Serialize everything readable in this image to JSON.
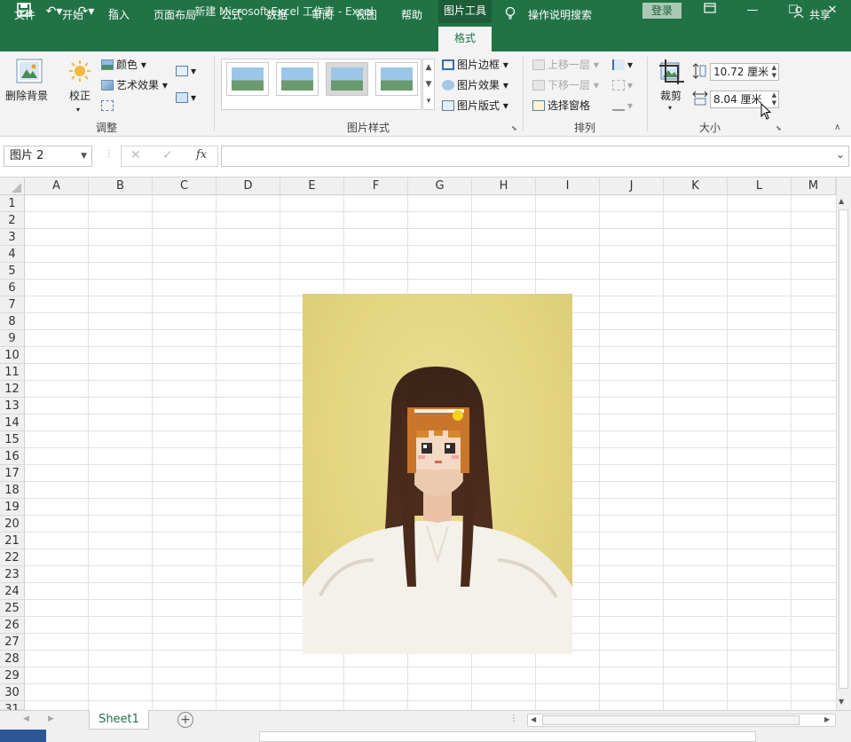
{
  "title_bar": {
    "document_title": "新建 Microsoft Excel 工作表  -  Excel",
    "context_tab_title": "图片工具",
    "login_label": "登录"
  },
  "ribbon_tabs": {
    "file": "文件",
    "home": "开始",
    "insert": "插入",
    "page_layout": "页面布局",
    "formulas": "公式",
    "data": "数据",
    "review": "审阅",
    "view": "视图",
    "help": "帮助",
    "format": "格式",
    "tell_me": "操作说明搜索",
    "share": "共享"
  },
  "ribbon": {
    "adjust": {
      "remove_background": "删除背景",
      "corrections": "校正",
      "color": "颜色",
      "artistic_effects": "艺术效果",
      "group_label": "调整"
    },
    "picture_styles": {
      "picture_border": "图片边框",
      "picture_effects": "图片效果",
      "picture_layout": "图片版式",
      "group_label": "图片样式"
    },
    "arrange": {
      "bring_forward": "上移一层",
      "send_backward": "下移一层",
      "selection_pane": "选择窗格",
      "group_label": "排列"
    },
    "size": {
      "crop": "裁剪",
      "height": "10.72 厘米",
      "width": "8.04 厘米",
      "group_label": "大小"
    }
  },
  "formula_bar": {
    "name_box": "图片 2",
    "fx": "fx",
    "formula": ""
  },
  "columns": [
    "A",
    "B",
    "C",
    "D",
    "E",
    "F",
    "G",
    "H",
    "I",
    "J",
    "K",
    "L",
    "M"
  ],
  "rows": [
    "1",
    "2",
    "3",
    "4",
    "5",
    "6",
    "7",
    "8",
    "9",
    "10",
    "11",
    "12",
    "13",
    "14",
    "15",
    "16",
    "17",
    "18",
    "19",
    "20",
    "21",
    "22",
    "23",
    "24",
    "25",
    "26",
    "27",
    "28",
    "29",
    "30",
    "31"
  ],
  "sheet_tabs": [
    "Sheet1"
  ],
  "colors": {
    "excel_green": "#217346",
    "ribbon_bg": "#f3f3f3",
    "photo_bg": "#e3d47f"
  }
}
